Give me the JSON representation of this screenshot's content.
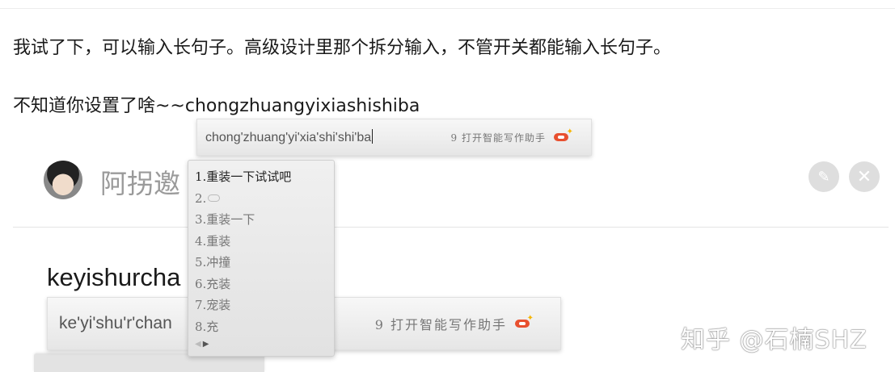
{
  "post": {
    "paragraph_1": "我试了下，可以输入长句子。高级设计里那个拆分输入，不管开关都能输入长句子。",
    "paragraph_2": "不知道你设置了啥~~chongzhuangyixiashishiba"
  },
  "ime_top": {
    "pinyin": "chong'zhuang'yi'xia'shi'shi'ba",
    "assistant": "9 打开智能写作助手"
  },
  "candidates": {
    "items": [
      "1.重装一下试试吧",
      "2.",
      "3.重装一下",
      "4.重装",
      "5.冲撞",
      "6.充装",
      "7.宠装",
      "8.充"
    ],
    "pager_prev": "◀",
    "pager_next": "▶"
  },
  "dialog": {
    "title_partial": "阿拐邀",
    "edit_icon": "✎",
    "close_icon": "✕",
    "input_text": "keyishurcha"
  },
  "ime_bottom": {
    "pinyin": "ke'yi'shu'r'chan",
    "assistant": "9 打开智能写作助手"
  },
  "watermark": "知乎 @石楠SHZ",
  "colors": {
    "pen_red": "#e8502f",
    "spark_yellow": "#f6b500"
  }
}
